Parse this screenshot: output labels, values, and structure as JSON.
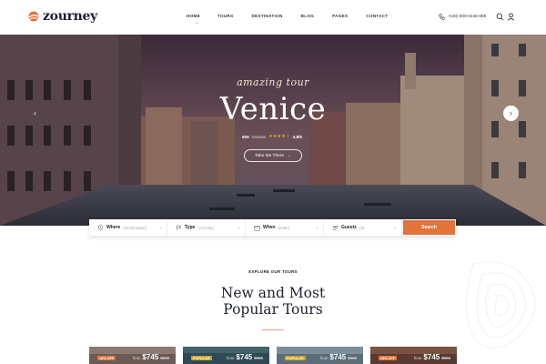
{
  "brand": {
    "name": "zourney",
    "accent": "#e0743b"
  },
  "nav": {
    "items": [
      {
        "label": "HOME"
      },
      {
        "label": "TOURS"
      },
      {
        "label": "DESTINATION"
      },
      {
        "label": "BLOG"
      },
      {
        "label": "PAGES"
      },
      {
        "label": "CONTACT"
      }
    ],
    "active_caret": "⌄"
  },
  "header": {
    "phone_icon": "phone-icon",
    "phone": "+(40) 800-0246 888",
    "search_icon": "search-icon",
    "user_icon": "user-icon"
  },
  "hero": {
    "tagline": "amazing tour",
    "title": "Venice",
    "reviews_count": "609",
    "reviews_label": "reviews",
    "stars": "★★★★☆",
    "rating": "4.8/5",
    "cta": "Take Me There",
    "cta_arrow": "→",
    "prev": "‹",
    "next": "›"
  },
  "search": {
    "fields": [
      {
        "label": "Where",
        "placeholder": "(Destination)",
        "icon": "location-icon"
      },
      {
        "label": "Type",
        "placeholder": "(Activity)",
        "icon": "flag-icon"
      },
      {
        "label": "When",
        "placeholder": "(Date)",
        "icon": "calendar-icon"
      },
      {
        "label": "Guests",
        "placeholder": "(0)",
        "icon": "guests-icon"
      }
    ],
    "caret": "⌄",
    "button": "Search"
  },
  "explore": {
    "kicker": "EXPLORE OUR TOURS",
    "title_line1": "New and Most",
    "title_line2": "Popular Tours"
  },
  "cards": [
    {
      "badge": "15% OFF",
      "badge_color": "#e0743b",
      "from": "from",
      "price": "$745",
      "old_price": "$950"
    },
    {
      "badge": "POPULAR",
      "badge_color": "#c9a227",
      "from": "from",
      "price": "$745",
      "old_price": "$950"
    },
    {
      "badge": "POPULAR",
      "badge_color": "#c9a227",
      "from": "from",
      "price": "$745",
      "old_price": "$950"
    },
    {
      "badge": "15% OFF",
      "badge_color": "#e0743b",
      "from": "from",
      "price": "$745",
      "old_price": "$950"
    }
  ]
}
